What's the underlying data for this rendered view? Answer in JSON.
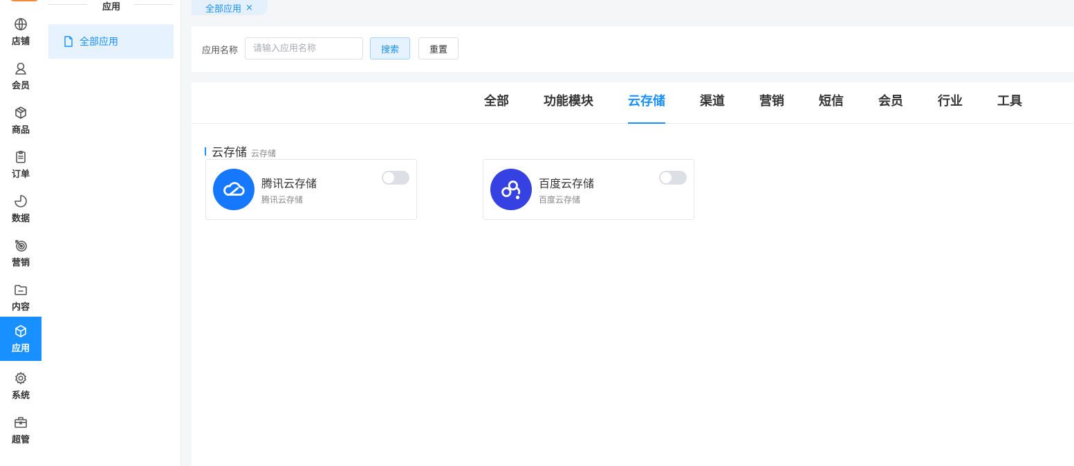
{
  "rail": {
    "items": [
      {
        "label": "店铺",
        "icon": "globe-icon"
      },
      {
        "label": "会员",
        "icon": "user-icon"
      },
      {
        "label": "商品",
        "icon": "box-icon"
      },
      {
        "label": "订单",
        "icon": "clipboard-icon"
      },
      {
        "label": "数据",
        "icon": "pie-chart-icon"
      },
      {
        "label": "营销",
        "icon": "target-icon"
      },
      {
        "label": "内容",
        "icon": "folder-icon"
      },
      {
        "label": "应用",
        "icon": "cube-icon",
        "active": true
      },
      {
        "label": "系统",
        "icon": "gear-icon"
      },
      {
        "label": "超管",
        "icon": "toolbox-icon"
      }
    ]
  },
  "submenu": {
    "title": "应用",
    "items": [
      {
        "label": "全部应用",
        "icon": "document-icon",
        "active": true
      }
    ]
  },
  "tabs": [
    {
      "label": "全部应用",
      "close": "×"
    }
  ],
  "search": {
    "label": "应用名称",
    "placeholder": "请输入应用名称",
    "value": "",
    "search_button": "搜索",
    "reset_button": "重置"
  },
  "categories": [
    {
      "label": "全部"
    },
    {
      "label": "功能模块"
    },
    {
      "label": "云存储",
      "active": true
    },
    {
      "label": "渠道"
    },
    {
      "label": "营销"
    },
    {
      "label": "短信"
    },
    {
      "label": "会员"
    },
    {
      "label": "行业"
    },
    {
      "label": "工具"
    }
  ],
  "section": {
    "title": "云存储",
    "subtitle": "云存储"
  },
  "apps": [
    {
      "name": "腾讯云存储",
      "desc": "腾讯云存储",
      "icon": "tencent-cloud-icon",
      "color": "#1677ff",
      "enabled": false
    },
    {
      "name": "百度云存储",
      "desc": "百度云存储",
      "icon": "baidu-cloud-icon",
      "color": "#3541e0",
      "enabled": false
    }
  ],
  "colors": {
    "accent": "#1890ff",
    "rail_active": "#1890ff",
    "logo": "#f28a3a"
  }
}
